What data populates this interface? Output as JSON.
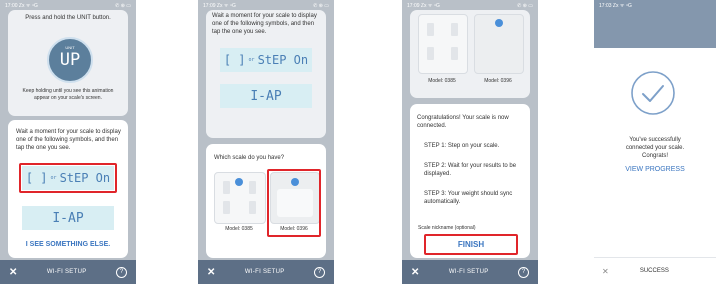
{
  "screens": [
    {
      "status": {
        "time": "17:00 Zx ᯤ ⁴G",
        "icons": "✆ ⊛ ▭"
      },
      "instruction_top": "Press and hold the UNIT button.",
      "unit_label": "UNIT",
      "unit_glyph": "UP",
      "keep_holding": "Keep holding until you see this animation appear on your scale's screen.",
      "wait_text": "Wait a moment for your scale to display one of the following symbols, and then tap the one you see.",
      "lcd_symbol_1": "[ ]",
      "lcd_or": "or",
      "lcd_symbol_2": "StEP On",
      "lcd_symbol_3": "I-AP",
      "link": "I SEE SOMETHING ELSE.",
      "nav_title": "WI-FI SETUP",
      "nav_close": "✕",
      "nav_help": "?"
    },
    {
      "status": {
        "time": "17:09 Zx ᯤ ⁴G",
        "icons": "✆ ⊛ ▭"
      },
      "wait_text": "Wait a moment for your scale to display one of the following symbols, and then tap the one you see.",
      "lcd_symbol_1": "[ ]",
      "lcd_or": "or",
      "lcd_symbol_2": "StEP On",
      "lcd_symbol_3": "I-AP",
      "question": "Which scale do you have?",
      "model_a": "Model: 0385",
      "model_b": "Model: 0396",
      "nav_title": "WI-FI SETUP",
      "nav_close": "✕",
      "nav_help": "?"
    },
    {
      "status": {
        "time": "17:09 Zx ᯤ ⁴G",
        "icons": "✆ ⊛ ▭"
      },
      "model_a": "Model: 0385",
      "model_b": "Model: 0396",
      "congrats": "Congratulations! Your scale is now connected.",
      "step1": "STEP 1: Step on your scale.",
      "step2": "STEP 2: Wait for your results to be displayed.",
      "step3": "STEP 3: Your weight should sync automatically.",
      "nickname": "Scale nickname (optional)",
      "finish": "FINISH",
      "nav_title": "WI-FI SETUP",
      "nav_close": "✕",
      "nav_help": "?"
    },
    {
      "status": {
        "time": "17:03 Zx ᯤ ⁴G",
        "icons": "✆ ⊛ ▭"
      },
      "success_line1": "You've successfully",
      "success_line2": "connected your scale.",
      "success_line3": "Congrats!",
      "view_progress": "VIEW PROGRESS",
      "footer_title": "SUCCESS",
      "footer_close": "✕"
    }
  ],
  "colors": {
    "accent": "#3b76c0",
    "nav": "#5d6f86",
    "highlight": "#e0252a",
    "lcd_bg": "#d8eef3",
    "check": "#7da0c9"
  }
}
